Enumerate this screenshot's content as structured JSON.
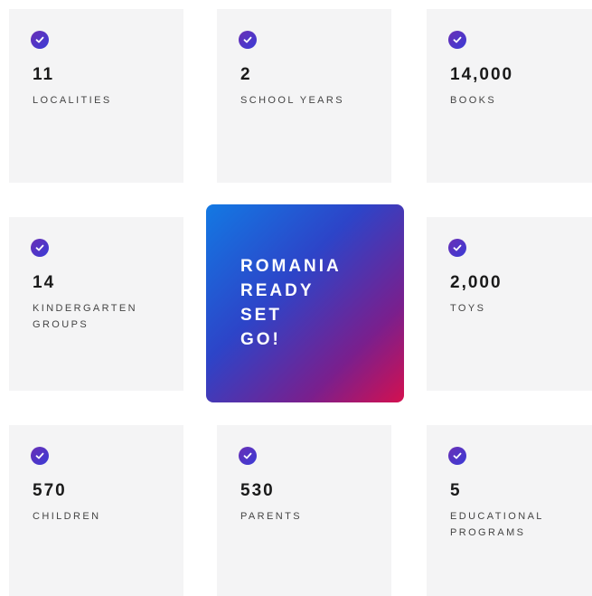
{
  "stats": [
    {
      "value": "11",
      "label": "LOCALITIES"
    },
    {
      "value": "2",
      "label": "SCHOOL YEARS"
    },
    {
      "value": "14,000",
      "label": "BOOKS"
    },
    {
      "value": "14",
      "label": "KINDERGARTEN GROUPS"
    },
    {
      "value": "2,000",
      "label": "TOYS"
    },
    {
      "value": "570",
      "label": "CHILDREN"
    },
    {
      "value": "530",
      "label": "PARENTS"
    },
    {
      "value": "5",
      "label": "EDUCATIONAL PROGRAMS"
    }
  ],
  "hero": {
    "lines": [
      "ROMANIA",
      "READY",
      "SET",
      "GO!"
    ]
  },
  "icons": {
    "card_icon": "check-circle-icon"
  },
  "colors": {
    "card_bg": "#f4f4f5",
    "check_purple": "#5b33c6",
    "gradient_start": "#1379e3",
    "gradient_end": "#d4104f"
  }
}
